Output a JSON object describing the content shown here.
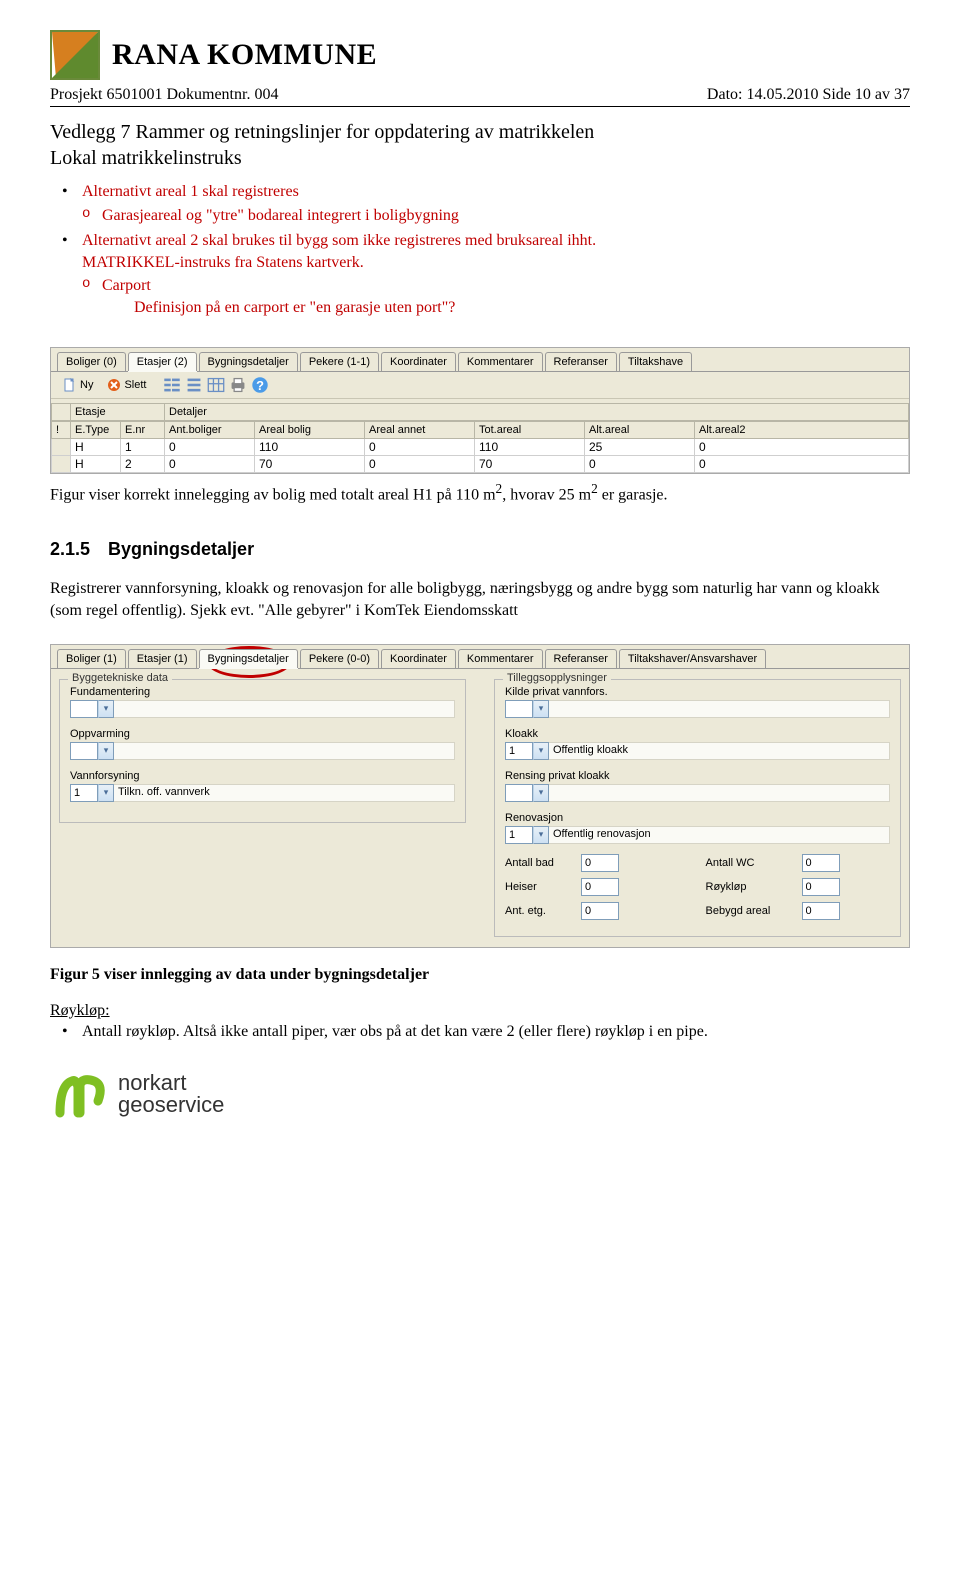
{
  "header": {
    "org_name": "RANA KOMMUNE"
  },
  "meta": {
    "left": "Prosjekt 6501001 Dokumentnr. 004",
    "right": "Dato: 14.05.2010  Side 10 av 37"
  },
  "title_line1": "Vedlegg 7 Rammer og retningslinjer for oppdatering av matrikkelen",
  "title_line2": "Lokal matrikkelinstruks",
  "bullet1": "Alternativt areal 1 skal registreres",
  "bullet1_sub1": "Garasjeareal og \"ytre\" bodareal integrert i boligbygning",
  "bullet2_l1": "Alternativt areal 2 skal brukes til bygg som ikke registreres med bruksareal ihht.",
  "bullet2_l2": "MATRIKKEL-instruks fra Statens kartverk.",
  "bullet2_sub1": "Carport",
  "bullet2_extra": "Definisjon på en carport er \"en garasje uten port\"?",
  "figure1": {
    "tabs": [
      "Boliger (0)",
      "Etasjer (2)",
      "Bygningsdetaljer",
      "Pekere (1-1)",
      "Koordinater",
      "Kommentarer",
      "Referanser",
      "Tiltakshave"
    ],
    "active_tab": "Etasjer (2)",
    "ny": "Ny",
    "slett": "Slett",
    "top_cols": [
      "",
      "Etasje",
      "Detaljer"
    ],
    "cols": [
      "!",
      "E.Type",
      "E.nr",
      "Ant.boliger",
      "Areal bolig",
      "Areal annet",
      "Tot.areal",
      "Alt.areal",
      "Alt.areal2"
    ],
    "rows": [
      [
        "",
        "H",
        "1",
        "0",
        "110",
        "0",
        "110",
        "25",
        "0"
      ],
      [
        "",
        "H",
        "2",
        "0",
        "70",
        "0",
        "70",
        "0",
        "0"
      ]
    ]
  },
  "caption1_a": "Figur viser korrekt innelegging av bolig med totalt areal H1 på 110 m",
  "caption1_b": ", hvorav 25 m",
  "caption1_c": " er garasje.",
  "section": {
    "num": "2.1.5",
    "title": "Bygningsdetaljer"
  },
  "para1": "Registrerer vannforsyning, kloakk og renovasjon for alle boligbygg, næringsbygg og andre bygg som naturlig har vann og kloakk (som regel offentlig). Sjekk evt. \"Alle gebyrer\" i KomTek Eiendomsskatt",
  "figure2": {
    "tabs": [
      "Boliger (1)",
      "Etasjer (1)",
      "Bygningsdetaljer",
      "Pekere (0-0)",
      "Koordinater",
      "Kommentarer",
      "Referanser",
      "Tiltakshaver/Ansvarshaver"
    ],
    "active_tab": "Bygningsdetaljer",
    "group_left": "Byggetekniske data",
    "group_right": "Tilleggsopplysninger",
    "left": {
      "fund_label": "Fundamentering",
      "oppv_label": "Oppvarming",
      "vann_label": "Vannforsyning",
      "vann_val": "1",
      "vann_side": "Tilkn. off. vannverk"
    },
    "right": {
      "kilde_label": "Kilde privat vannfors.",
      "kloakk_label": "Kloakk",
      "kloakk_val": "1",
      "kloakk_side": "Offentlig kloakk",
      "rens_label": "Rensing privat kloakk",
      "renov_label": "Renovasjon",
      "renov_val": "1",
      "renov_side": "Offentlig renovasjon",
      "antall_bad_label": "Antall bad",
      "antall_bad": "0",
      "antall_wc_label": "Antall WC",
      "antall_wc": "0",
      "heiser_label": "Heiser",
      "heiser": "0",
      "royklop_label": "Røykløp",
      "royklop": "0",
      "antetg_label": "Ant. etg.",
      "antetg": "0",
      "bebygd_label": "Bebygd areal",
      "bebygd": "0"
    }
  },
  "fig5_caption": "Figur 5 viser innlegging av data under bygningsdetaljer",
  "royklop_head": "Røykløp:",
  "royklop_bullet": "Antall røykløp. Altså ikke antall piper, vær obs på at det kan være 2 (eller flere) røykløp i en pipe.",
  "footer": {
    "l1": "norkart",
    "l2": "geoservice"
  }
}
